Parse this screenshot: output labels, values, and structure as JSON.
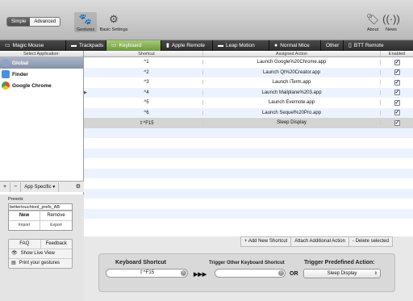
{
  "toolbar": {
    "mode_simple": "Simple",
    "mode_advanced": "Advanced",
    "gestures": "Gestures",
    "basic_settings": "Basic Settings",
    "about": "About",
    "news": "News"
  },
  "tabs": [
    {
      "label": "Magic Mouse",
      "icon": "mouse-icon"
    },
    {
      "label": "Trackpads",
      "icon": "trackpad-icon"
    },
    {
      "label": "Keyboard",
      "icon": "keyboard-icon"
    },
    {
      "label": "Apple Remote",
      "icon": "remote-icon"
    },
    {
      "label": "Leap Motion",
      "icon": "leap-icon"
    },
    {
      "label": "Normal Mice",
      "icon": "mouse-icon"
    },
    {
      "label": "Other",
      "icon": ""
    },
    {
      "label": "BTT Remote",
      "icon": "phone-icon"
    }
  ],
  "sidebar": {
    "header": "Select Application:",
    "apps": [
      {
        "label": "Global",
        "color": "#8fa3c4"
      },
      {
        "label": "Finder",
        "color": "#4a8fe0"
      },
      {
        "label": "Google Chrome",
        "color": "#e0483c"
      }
    ],
    "add": "+",
    "remove": "−",
    "app_specific": "App Specific ▾",
    "gear": "⚙"
  },
  "presets": {
    "label": "Presets",
    "current": "bettertouchtool_prefs_AB",
    "new": "New",
    "remove": "Remove",
    "import": "Import",
    "export": "Export",
    "faq": "FAQ",
    "feedback": "Feedback",
    "show_live_view": "Show Live View",
    "print_gestures": "Print your gestures"
  },
  "table": {
    "headers": {
      "shortcut": "Shortcut",
      "action": "Assigned Action",
      "enabled": "Enabled"
    },
    "rows": [
      {
        "shortcut": "^1",
        "action": "Launch Google%20Chrome.app",
        "enabled": "✓"
      },
      {
        "shortcut": "^2",
        "action": "Launch Qt%20Creator.app",
        "enabled": "✓"
      },
      {
        "shortcut": "^3",
        "action": "Launch iTerm.app",
        "enabled": "✓"
      },
      {
        "shortcut": "^4",
        "action": "Launch Mailplane%203.app",
        "enabled": "✓"
      },
      {
        "shortcut": "^5",
        "action": "Launch Evernote.app",
        "enabled": "✓"
      },
      {
        "shortcut": "^6",
        "action": "Launch Sequel%20Pro.app",
        "enabled": "✓"
      },
      {
        "shortcut": "⇧^F15",
        "action": "Sleep Display",
        "enabled": "✓"
      }
    ],
    "add_new": "+ Add New Shortcut",
    "attach": "Attach Additional Action",
    "delete": "- Delete selected"
  },
  "bottom": {
    "keyboard_shortcut_label": "Keyboard Shortcut",
    "keyboard_shortcut_value": "⇧^F15",
    "trigger_other_label": "Trigger Other Keyboard Shortcut",
    "trigger_other_value": "",
    "arrows": "▶▶▶",
    "or": "OR",
    "predefined_label": "Trigger Predefined Action:",
    "predefined_value": "Sleep Display"
  }
}
